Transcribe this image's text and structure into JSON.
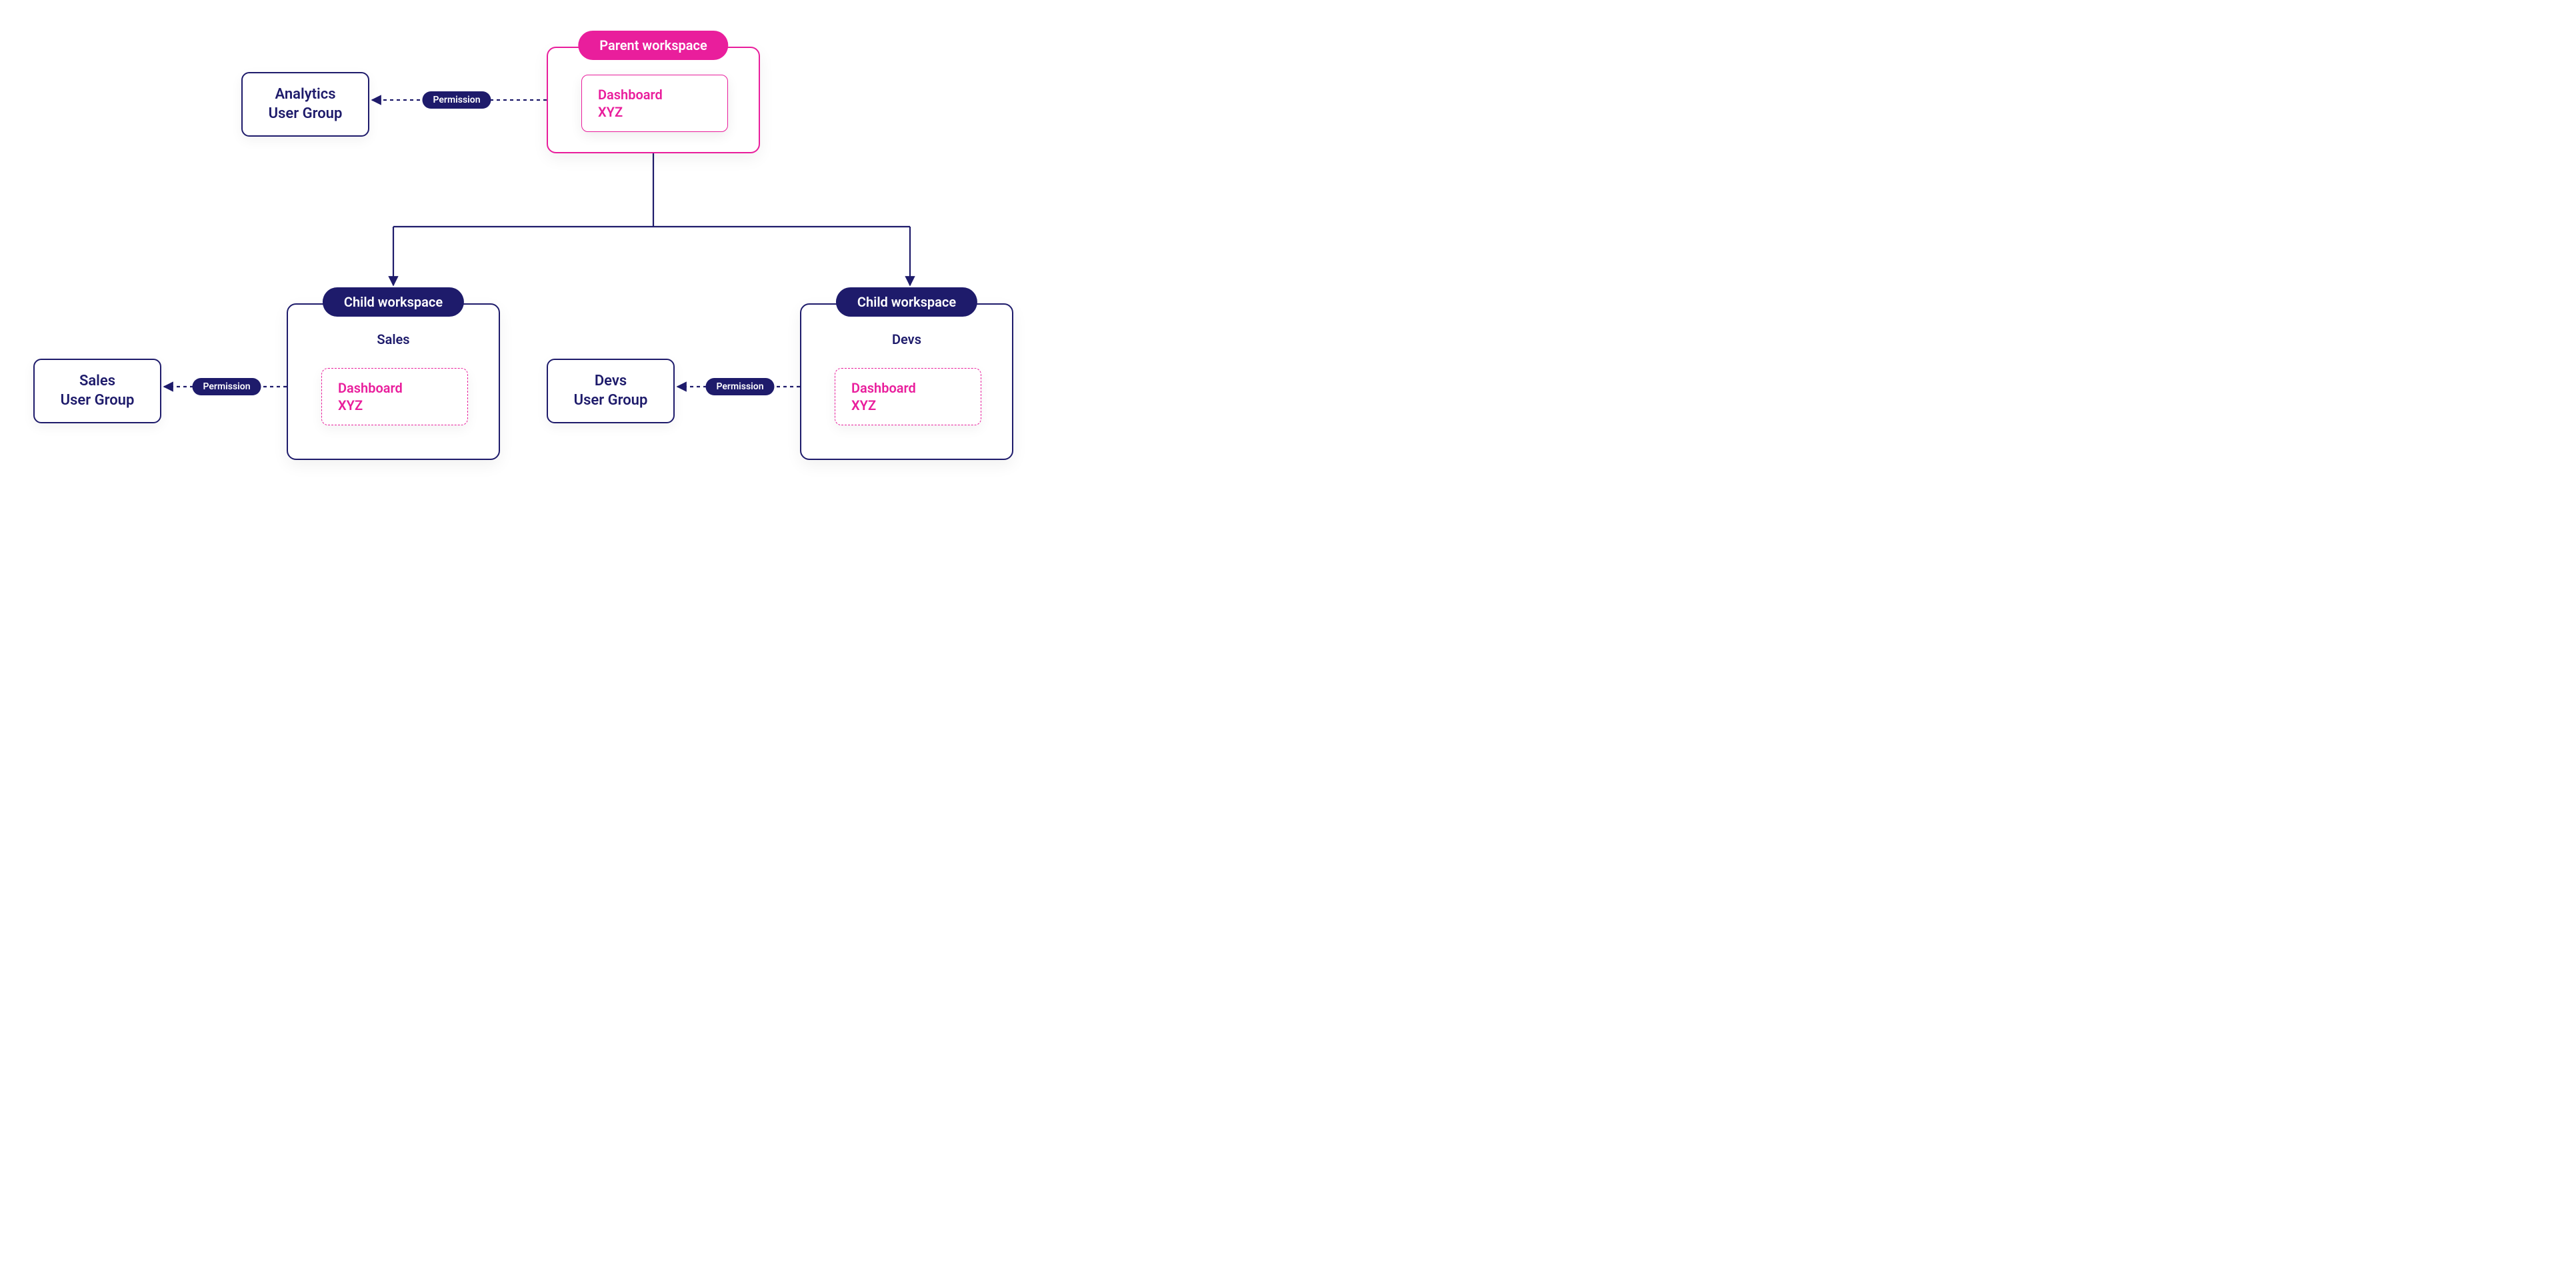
{
  "colors": {
    "pink": "#E91E9C",
    "navy": "#1E1B6B"
  },
  "parent_workspace": {
    "title": "Parent workspace",
    "dashboard_line1": "Dashboard",
    "dashboard_line2": "XYZ"
  },
  "child_workspaces": [
    {
      "title": "Child workspace",
      "name": "Sales",
      "dashboard_line1": "Dashboard",
      "dashboard_line2": "XYZ"
    },
    {
      "title": "Child workspace",
      "name": "Devs",
      "dashboard_line1": "Dashboard",
      "dashboard_line2": "XYZ"
    }
  ],
  "user_groups": {
    "analytics": {
      "line1": "Analytics",
      "line2": "User Group"
    },
    "sales": {
      "line1": "Sales",
      "line2": "User Group"
    },
    "devs": {
      "line1": "Devs",
      "line2": "User Group"
    }
  },
  "permission_label": "Permission"
}
